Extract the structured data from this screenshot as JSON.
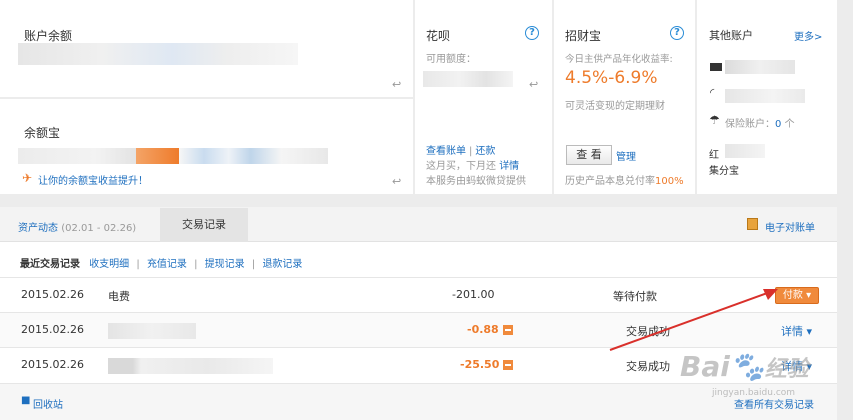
{
  "balance": {
    "title": "账户余额"
  },
  "yuebao": {
    "title": "余额宝",
    "promo": "让你的余额宝收益提升！"
  },
  "huabei": {
    "title": "花呗",
    "help": "?",
    "credit_label": "可用额度：",
    "view_bill": "查看账单",
    "sep": "|",
    "repay": "还款",
    "buy_note": "这月买，下月还",
    "details": "详情",
    "service_note": "本服务由蚂蚁微贷提供"
  },
  "zhaocaibao": {
    "title": "招财宝",
    "help": "?",
    "rate_label": "今日主供产品年化收益率:",
    "rate": "4.5%-6.9%",
    "desc": "可灵活变现的定期理财",
    "view_btn": "查 看",
    "manage": "管理",
    "history_prefix": "历史产品本息兑付率",
    "history_rate": "100%"
  },
  "other_accounts": {
    "title": "其他账户",
    "more": "更多>",
    "insurance_label": "保险账户：",
    "insurance_count": "0",
    "insurance_unit": "个",
    "hongbao": "红",
    "jifen": "集分宝"
  },
  "tabs": {
    "asset_dynamics": "资产动态",
    "date_range": "(02.01 - 02.26)",
    "transactions": "交易记录",
    "e_statement": "电子对账单"
  },
  "subnav": {
    "recent": "最近交易记录",
    "income_expense": "收支明细",
    "recharge": "充值记录",
    "withdraw": "提现记录",
    "refund": "退款记录",
    "sep": "|"
  },
  "transactions": [
    {
      "date": "2015.02.26",
      "name": "电费",
      "amount": "-201.00",
      "status": "等待付款",
      "action": "付款 ▾"
    },
    {
      "date": "2015.02.26",
      "name": "",
      "amount": "-0.88",
      "status": "交易成功",
      "action": "详情 ▾"
    },
    {
      "date": "2015.02.26",
      "name": "",
      "amount": "-25.50",
      "status": "交易成功",
      "action": "详情 ▾"
    }
  ],
  "footer": {
    "recycle": "回收站",
    "view_all": "查看所有交易记录"
  },
  "watermark": {
    "brand": "Bai",
    "brand2": "经验",
    "url": "jingyan.baidu.com"
  },
  "colors": {
    "accent_orange": "#ee7b2b",
    "link_blue": "#1e6fbf",
    "pay_button": "#f08a3c",
    "arrow_red": "#d9302b"
  }
}
